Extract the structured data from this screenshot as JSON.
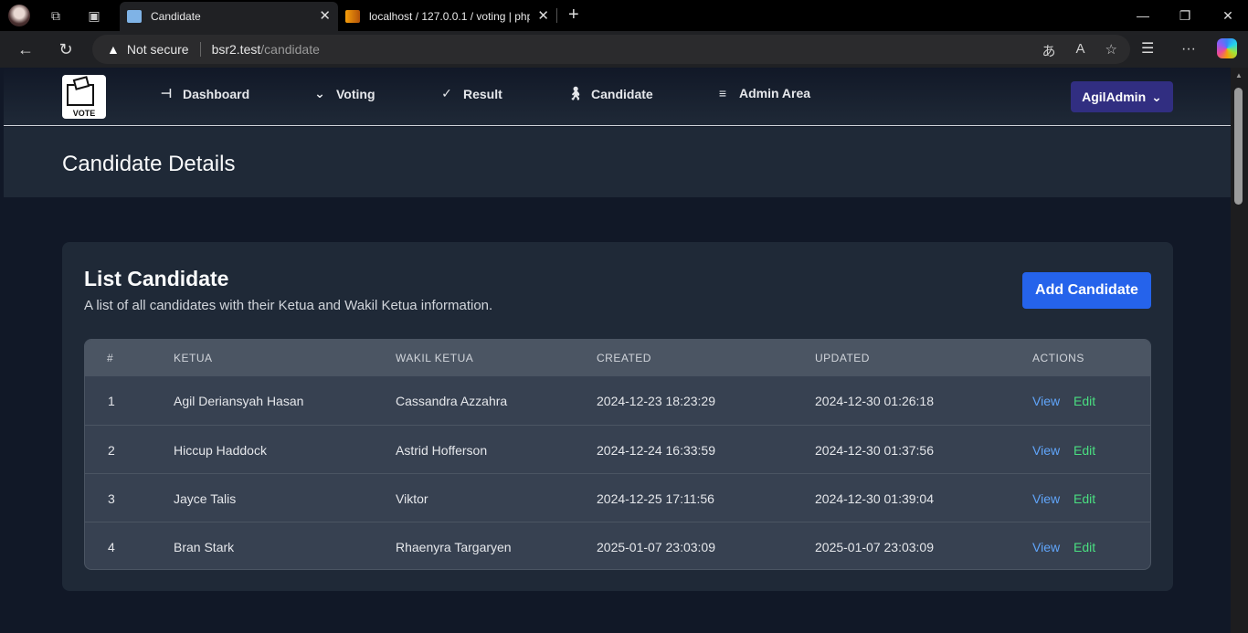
{
  "browser": {
    "tabs": [
      {
        "title": "Candidate",
        "active": true
      },
      {
        "title": "localhost / 127.0.0.1 / voting | php",
        "active": false
      }
    ],
    "security": "Not secure",
    "url_host": "bsr2.test",
    "url_path": "/candidate"
  },
  "app": {
    "logo_text": "VOTE",
    "nav": [
      {
        "label": "Dashboard",
        "icon": "dashboard-icon"
      },
      {
        "label": "Voting",
        "icon": "chevron-down-icon"
      },
      {
        "label": "Result",
        "icon": "result-icon"
      },
      {
        "label": "Candidate",
        "icon": "person-icon"
      },
      {
        "label": "Admin Area",
        "icon": "admin-icon"
      }
    ],
    "user": "AgilAdmin"
  },
  "page": {
    "title": "Candidate Details",
    "card_title": "List Candidate",
    "card_desc": "A list of all candidates with their Ketua and Wakil Ketua information.",
    "add_button": "Add Candidate"
  },
  "table": {
    "headers": [
      "#",
      "KETUA",
      "WAKIL KETUA",
      "CREATED",
      "UPDATED",
      "ACTIONS"
    ],
    "rows": [
      {
        "no": "1",
        "ketua": "Agil Deriansyah Hasan",
        "wakil": "Cassandra Azzahra",
        "created": "2024-12-23 18:23:29",
        "updated": "2024-12-30 01:26:18"
      },
      {
        "no": "2",
        "ketua": "Hiccup Haddock",
        "wakil": "Astrid Hofferson",
        "created": "2024-12-24 16:33:59",
        "updated": "2024-12-30 01:37:56"
      },
      {
        "no": "3",
        "ketua": "Jayce Talis",
        "wakil": "Viktor",
        "created": "2024-12-25 17:11:56",
        "updated": "2024-12-30 01:39:04"
      },
      {
        "no": "4",
        "ketua": "Bran Stark",
        "wakil": "Rhaenyra Targaryen",
        "created": "2025-01-07 23:03:09",
        "updated": "2025-01-07 23:03:09"
      }
    ],
    "view_label": "View",
    "edit_label": "Edit"
  }
}
